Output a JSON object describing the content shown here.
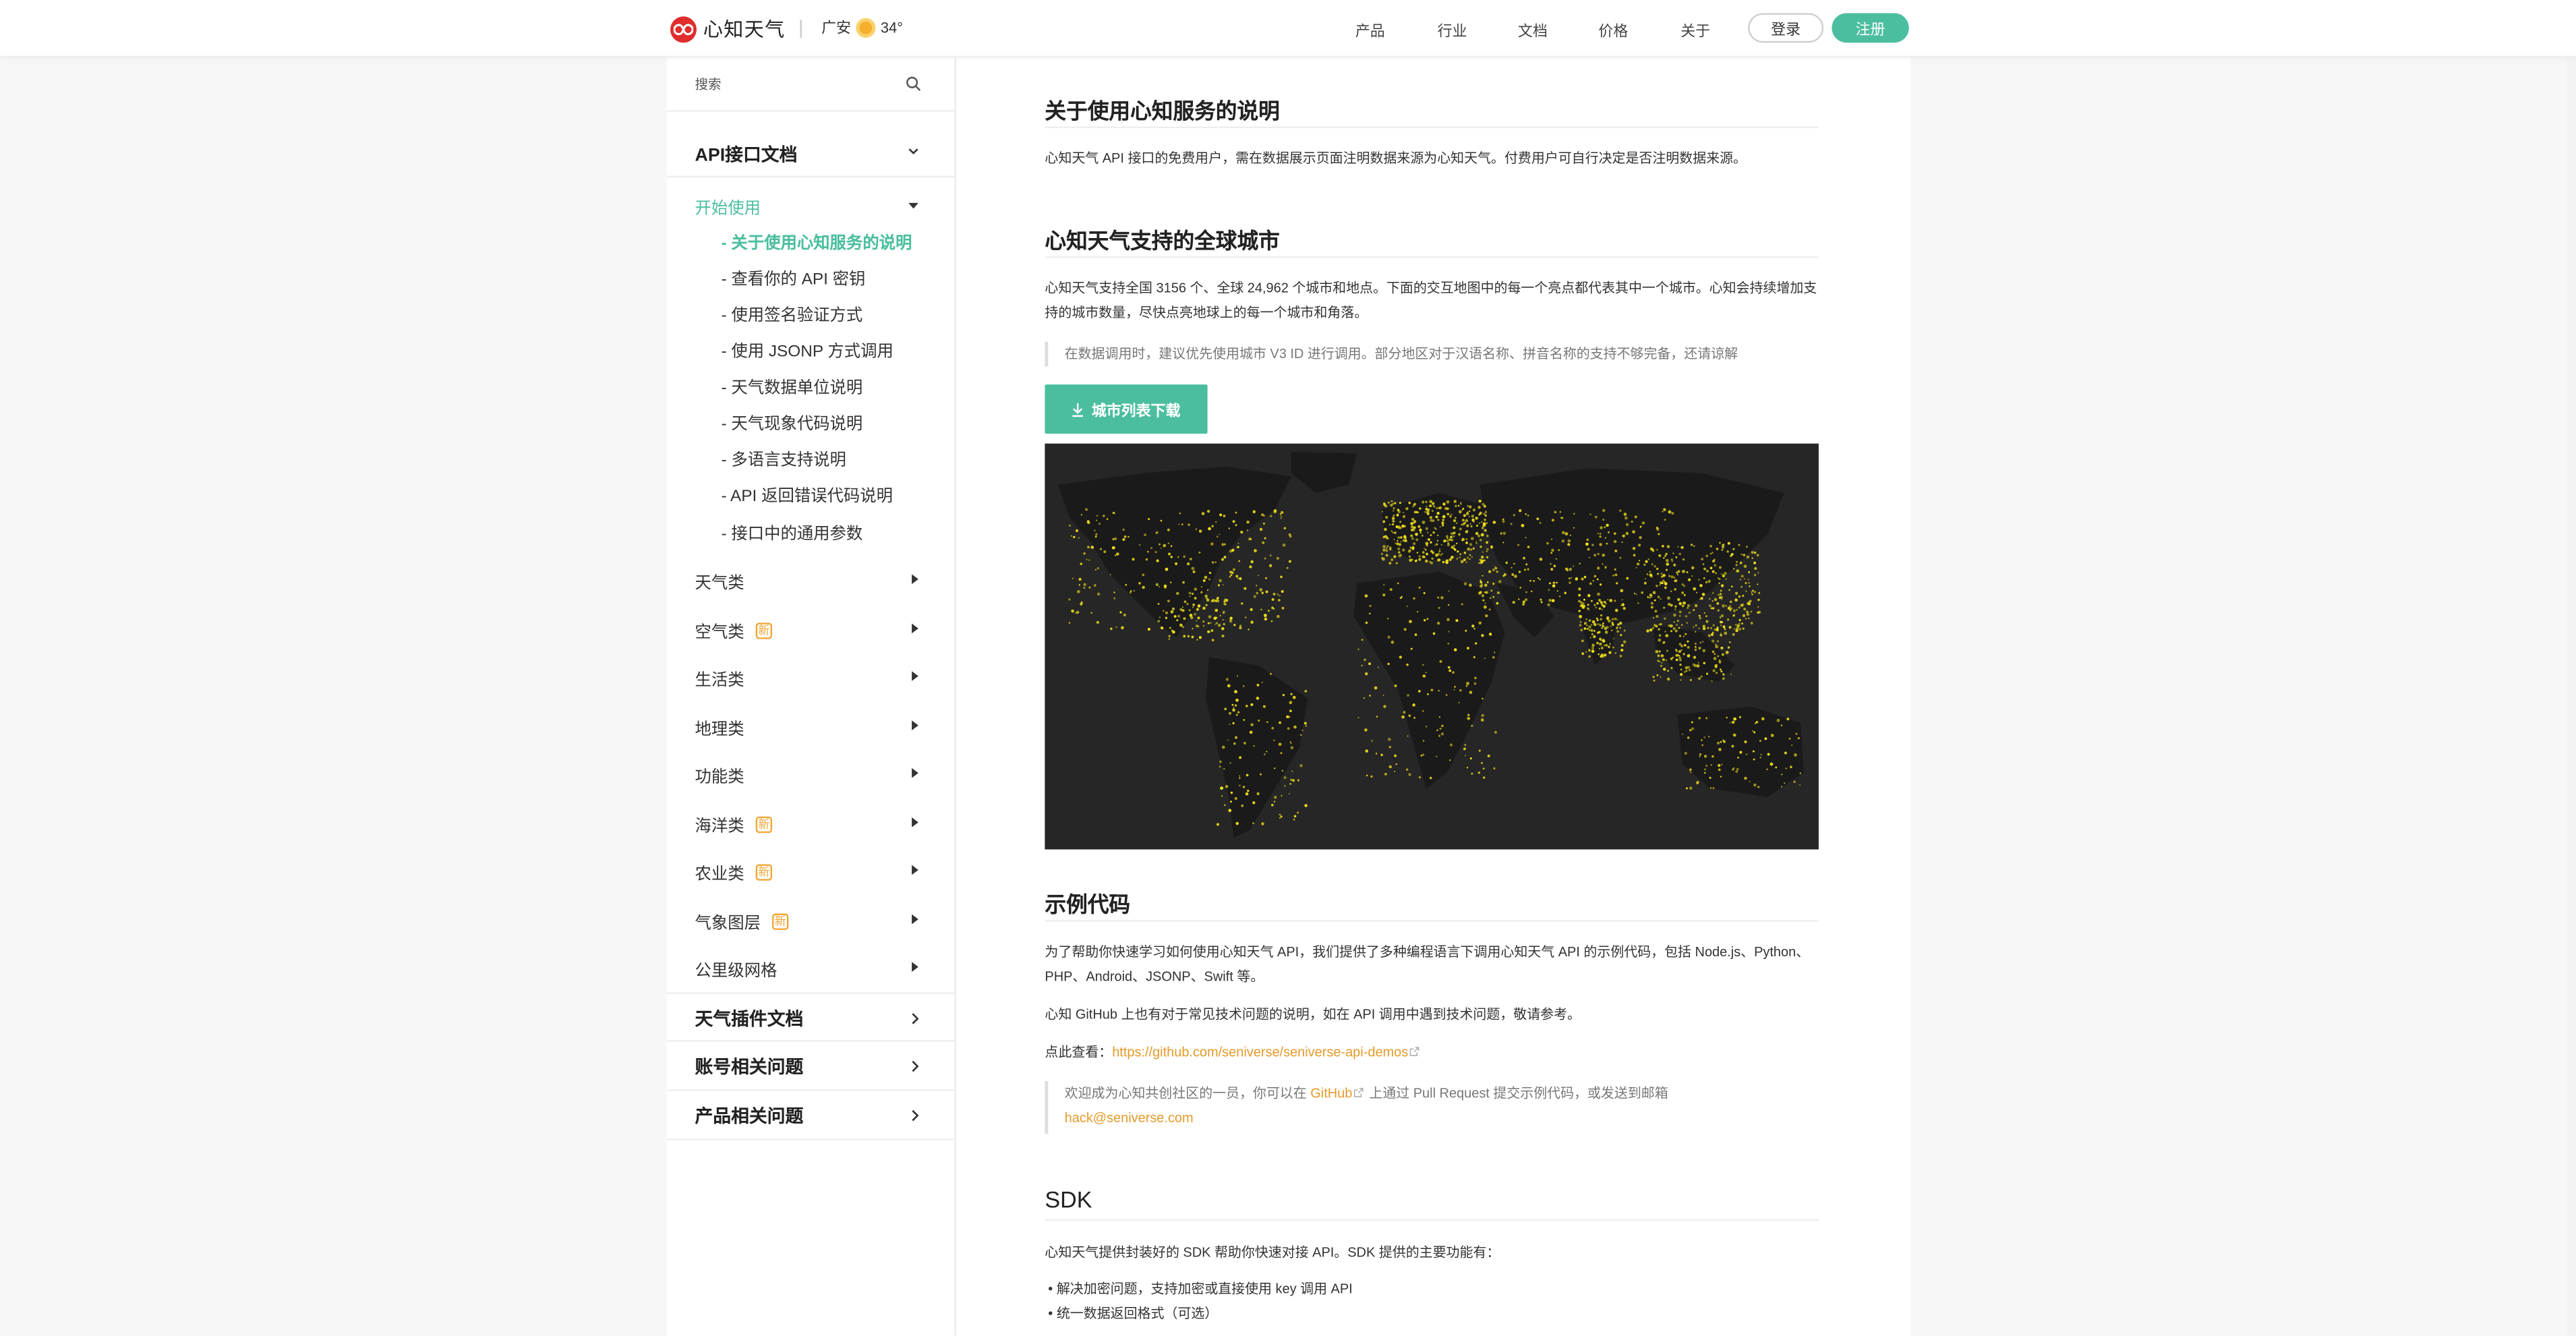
{
  "header": {
    "brand": "心知天气",
    "location": "广安",
    "temperature": "34°",
    "nav": [
      "产品",
      "行业",
      "文档",
      "价格",
      "关于"
    ],
    "login": "登录",
    "register": "注册"
  },
  "sidebar": {
    "search_placeholder": "搜索",
    "api_docs": "API接口文档",
    "getting_started": "开始使用",
    "sub_items": [
      "关于使用心知服务的说明",
      "查看你的 API 密钥",
      "使用签名验证方式",
      "使用 JSONP 方式调用",
      "天气数据单位说明",
      "天气现象代码说明",
      "多语言支持说明",
      "API 返回错误代码说明",
      "接口中的通用参数"
    ],
    "categories": [
      {
        "label": "天气类",
        "badge": ""
      },
      {
        "label": "空气类",
        "badge": "新"
      },
      {
        "label": "生活类",
        "badge": ""
      },
      {
        "label": "地理类",
        "badge": ""
      },
      {
        "label": "功能类",
        "badge": ""
      },
      {
        "label": "海洋类",
        "badge": "新"
      },
      {
        "label": "农业类",
        "badge": "新"
      },
      {
        "label": "气象图层",
        "badge": "新"
      },
      {
        "label": "公里级网格",
        "badge": ""
      }
    ],
    "big_sections": [
      "天气插件文档",
      "账号相关问题",
      "产品相关问题"
    ]
  },
  "main": {
    "s1_title": "关于使用心知服务的说明",
    "s1_p": "心知天气 API 接口的免费用户，需在数据展示页面注明数据来源为心知天气。付费用户可自行决定是否注明数据来源。",
    "s2_title": "心知天气支持的全球城市",
    "s2_p1": "心知天气支持全国 3156 个、全球 24,962 个城市和地点。下面的交互地图中的每一个亮点都代表其中一个城市。心知会持续增加支持的城市数量，尽快点亮地球上的每一个城市和角落。",
    "s2_quote": "在数据调用时，建议优先使用城市 V3 ID 进行调用。部分地区对于汉语名称、拼音名称的支持不够完备，还请谅解",
    "download_btn": "城市列表下载",
    "s3_title": "示例代码",
    "s3_p1": "为了帮助你快速学习如何使用心知天气 API，我们提供了多种编程语言下调用心知天气 API 的示例代码，包括 Node.js、Python、PHP、Android、JSONP、Swift 等。",
    "s3_p2": "心知 GitHub 上也有对于常见技术问题的说明，如在 API 调用中遇到技术问题，敬请参考。",
    "s3_view_label": "点此查看：",
    "s3_link": "https://github.com/seniverse/seniverse-api-demos",
    "s3_quote_a": "欢迎成为心知共创社区的一员，你可以在 ",
    "s3_quote_github": "GitHub",
    "s3_quote_b": " 上通过 Pull Request 提交示例代码，或发送到邮箱",
    "s3_quote_email": "hack@seniverse.com",
    "s4_title": "SDK",
    "s4_p": "心知天气提供封装好的 SDK 帮助你快速对接 API。SDK 提供的主要功能有：",
    "s4_bullets": [
      "解决加密问题，支持加密或直接使用 key 调用 API",
      "统一数据返回格式（可选）"
    ]
  },
  "colors": {
    "accent": "#4cbea0",
    "link": "#e59a2a",
    "brand_red": "#e02d2d",
    "badge": "#f0a83a"
  }
}
